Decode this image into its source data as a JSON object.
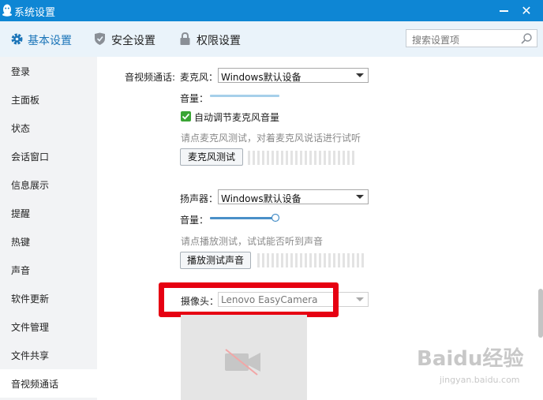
{
  "window": {
    "title": "系统设置",
    "close_glyph": "✕"
  },
  "toolbar": {
    "tabs": [
      {
        "label": "基本设置",
        "icon": "gear-icon",
        "active": true
      },
      {
        "label": "安全设置",
        "icon": "shield-icon",
        "active": false
      },
      {
        "label": "权限设置",
        "icon": "lock-icon",
        "active": false
      }
    ],
    "search_placeholder": "搜索设置项"
  },
  "sidebar": {
    "items": [
      {
        "label": "登录"
      },
      {
        "label": "主面板"
      },
      {
        "label": "状态"
      },
      {
        "label": "会话窗口"
      },
      {
        "label": "信息展示"
      },
      {
        "label": "提醒"
      },
      {
        "label": "热键"
      },
      {
        "label": "声音"
      },
      {
        "label": "软件更新"
      },
      {
        "label": "文件管理"
      },
      {
        "label": "文件共享"
      },
      {
        "label": "音视频通话",
        "active": true
      }
    ]
  },
  "av": {
    "section_label": "音视频通话:",
    "mic": {
      "label": "麦克风：",
      "device": "Windows默认设备",
      "volume_label": "音量：",
      "volume_level": 1.0,
      "auto_adjust_label": "自动调节麦克风音量",
      "auto_adjust_checked": true,
      "hint": "请点麦克风测试，对着麦克风说话进行试听",
      "test_button": "麦克风测试"
    },
    "speaker": {
      "label": "扬声器：",
      "device": "Windows默认设备",
      "volume_label": "音量：",
      "volume_level": 1.0,
      "hint": "请点播放测试，试试能否听到声音",
      "test_button": "播放测试声音"
    },
    "camera": {
      "label": "摄像头：",
      "device": "Lenovo EasyCamera",
      "preview_icon": "camera-off-icon"
    }
  },
  "watermark": {
    "main": "Baidu经验",
    "sub": "jingyan.baidu.com"
  },
  "colors": {
    "titlebar": "#0e86d4",
    "accent": "#1a74b8",
    "highlight": "#e60012",
    "checkbox": "#3aa535"
  }
}
